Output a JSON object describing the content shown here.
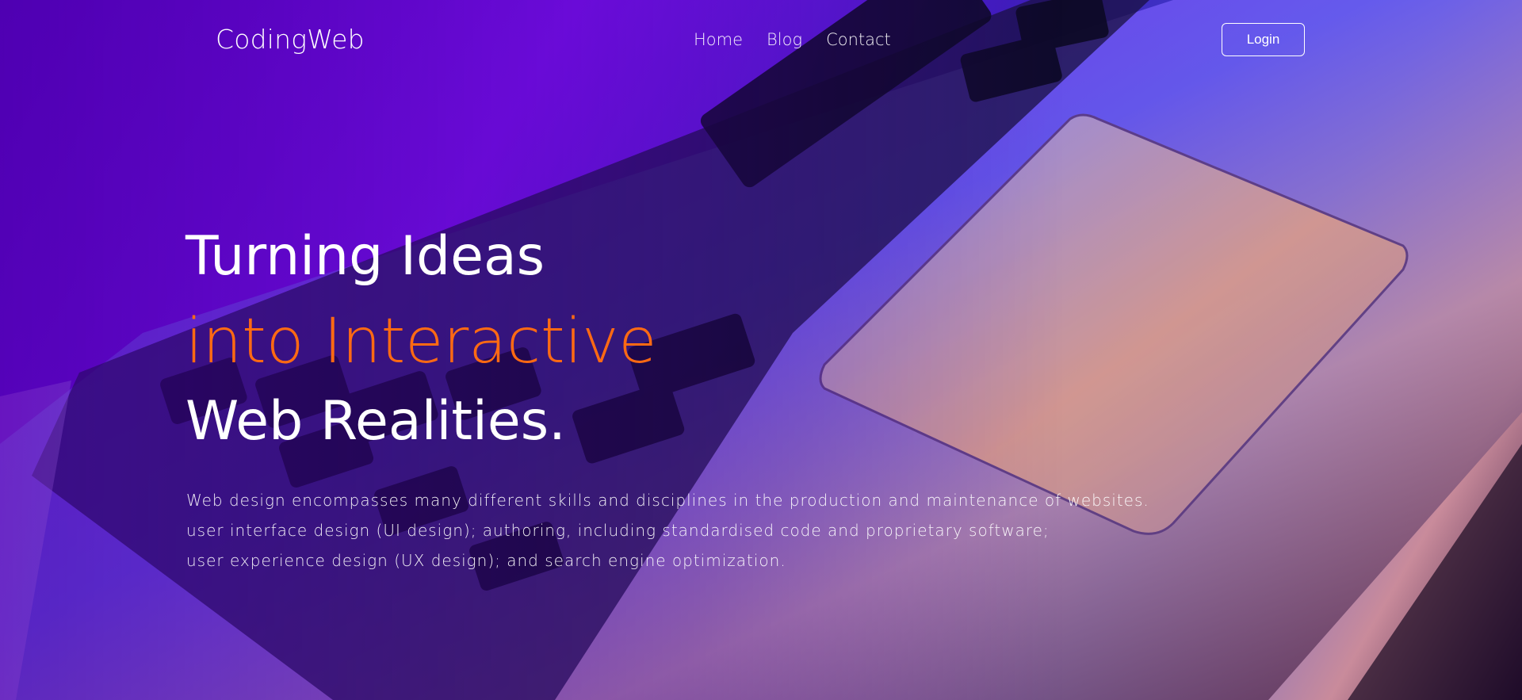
{
  "brand": {
    "name": "CodingWeb"
  },
  "nav": {
    "links": [
      "Home",
      "Blog",
      "Contact"
    ],
    "login_label": "Login"
  },
  "hero": {
    "line1": "Turning Ideas",
    "line2": "into Interactive",
    "line3": "Web Realities.",
    "description": [
      "Web design encompasses many different skills and disciplines in the production and maintenance of websites.",
      "user interface design (UI design); authoring, including standardised code and proprietary software;",
      "user experience design (UX design); and search engine optimization."
    ]
  },
  "colors": {
    "accent": "#ff6a13",
    "primary_text": "#ffffff",
    "background_purple": "#7a10f0",
    "background_blue": "#4b5ee0"
  }
}
